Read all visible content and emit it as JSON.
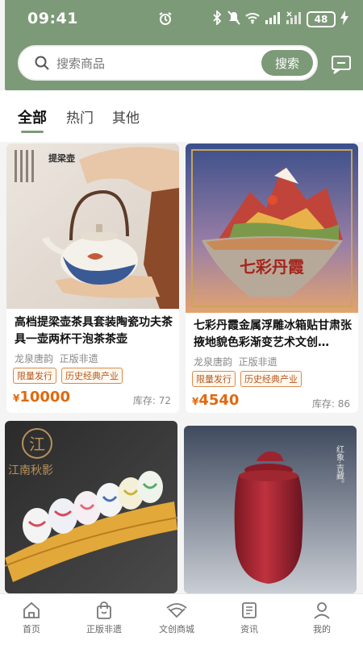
{
  "status_bar": {
    "time": "09:41",
    "battery": "48"
  },
  "search": {
    "placeholder": "搜索商品",
    "button_label": "搜索"
  },
  "tabs": [
    {
      "label": "全部",
      "active": true
    },
    {
      "label": "热门",
      "active": false
    },
    {
      "label": "其他",
      "active": false
    }
  ],
  "products": [
    {
      "title": "高档提梁壶茶具套装陶瓷功夫茶具一壶两杯干泡茶茶壶",
      "image_text": "提梁壶",
      "brand": "龙泉唐韵",
      "badge": "正版非遗",
      "tags": [
        "限量发行",
        "历史经典产业"
      ],
      "currency": "¥",
      "price": "10000",
      "stock_label": "库存: 72"
    },
    {
      "title": "七彩丹霞金属浮雕冰箱贴甘肃张掖地貌色彩渐变艺术文创…",
      "image_text": "七彩丹霞",
      "brand": "龙泉唐韵",
      "badge": "正版非遗",
      "tags": [
        "限量发行",
        "历史经典产业"
      ],
      "currency": "¥",
      "price": "4540",
      "stock_label": "库存: 86"
    },
    {
      "image_text": "江南秋影",
      "logo_text": "江"
    },
    {
      "image_text": "红象·吉藏。"
    }
  ],
  "bottom_nav": [
    {
      "label": "首页",
      "icon": "home-icon"
    },
    {
      "label": "正版非遗",
      "icon": "shopping-bag-icon"
    },
    {
      "label": "文创商城",
      "icon": "wifi-hat-icon"
    },
    {
      "label": "资讯",
      "icon": "news-icon"
    },
    {
      "label": "我的",
      "icon": "user-icon"
    }
  ],
  "colors": {
    "brand": "#7d9a78",
    "price": "#e06a10",
    "tag": "#b35a1f"
  }
}
